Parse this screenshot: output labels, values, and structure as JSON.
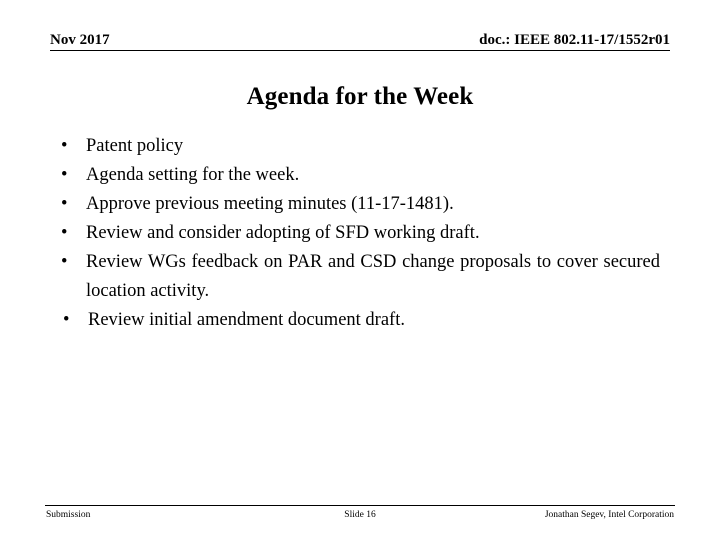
{
  "slide": {
    "background_color": "#ffffff",
    "text_color": "#000000"
  },
  "header": {
    "left": "Nov 2017",
    "right": "doc.: IEEE 802.11-17/1552r01"
  },
  "title": "Agenda for the Week",
  "bullets": [
    {
      "marker": "•",
      "text": "Patent policy"
    },
    {
      "marker": "•",
      "text": "Agenda setting for the week."
    },
    {
      "marker": "•",
      "text": "Approve previous meeting minutes (11-17-1481)."
    },
    {
      "marker": "•",
      "text": "Review and consider adopting of SFD working draft."
    },
    {
      "marker": "•",
      "text": "Review WGs feedback on PAR and CSD change proposals to cover secured location activity."
    },
    {
      "marker": "•",
      "text": "Review initial amendment document draft."
    }
  ],
  "footer": {
    "left": "Submission",
    "center": "Slide 16",
    "right": "Jonathan Segev, Intel Corporation"
  }
}
